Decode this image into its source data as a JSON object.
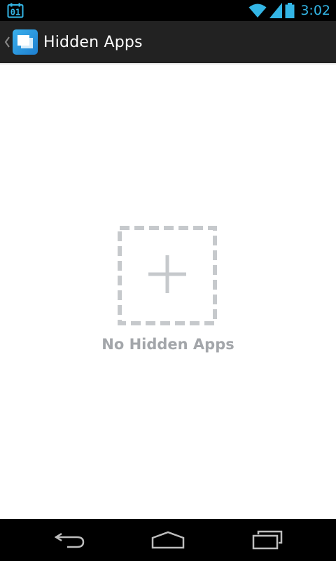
{
  "status_bar": {
    "notification_date": "01",
    "time": "3:02",
    "icons": [
      "calendar-icon",
      "wifi-icon",
      "signal-icon",
      "battery-icon"
    ],
    "accent_color": "#33b5e5"
  },
  "action_bar": {
    "title": "Hidden Apps",
    "icons": [
      "up-caret-icon",
      "hidden-apps-icon"
    ],
    "background": "#222222"
  },
  "empty_state": {
    "message": "No Hidden Apps",
    "icon": "add-dashed-box-icon",
    "color": "#a3a6aa"
  },
  "nav_bar": {
    "icons": [
      "back-icon",
      "home-icon",
      "recent-apps-icon"
    ]
  }
}
